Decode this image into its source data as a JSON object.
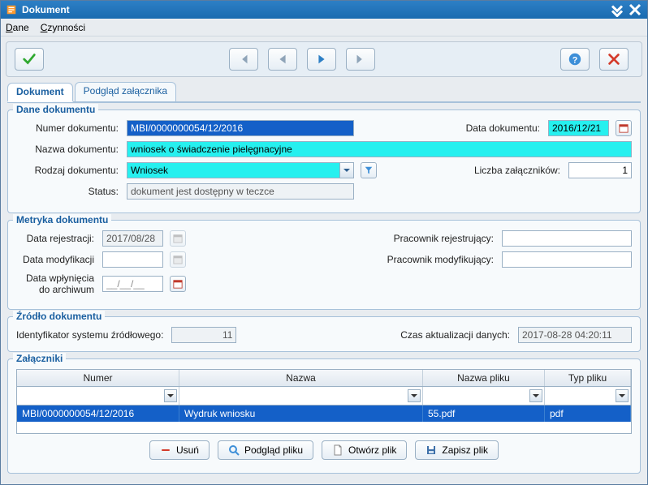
{
  "window": {
    "title": "Dokument"
  },
  "menubar": {
    "dane": "Dane",
    "czynnosci": "Czynności"
  },
  "tabs": {
    "dokument": "Dokument",
    "podglad": "Podgląd załącznika"
  },
  "dane_dokumentu": {
    "legend": "Dane dokumentu",
    "numer_label": "Numer dokumentu:",
    "numer_value": "MBI/0000000054/12/2016",
    "data_label": "Data dokumentu:",
    "data_value": "2016/12/21",
    "nazwa_label": "Nazwa dokumentu:",
    "nazwa_value": "wniosek o świadczenie pielęgnacyjne",
    "rodzaj_label": "Rodzaj dokumentu:",
    "rodzaj_value": "Wniosek",
    "liczba_label": "Liczba załączników:",
    "liczba_value": "1",
    "status_label": "Status:",
    "status_value": "dokument jest dostępny w teczce"
  },
  "metryka": {
    "legend": "Metryka dokumentu",
    "data_rej_label": "Data rejestracji:",
    "data_rej_value": "2017/08/28",
    "prac_rej_label": "Pracownik rejestrujący:",
    "prac_rej_value": "",
    "data_mod_label": "Data modyfikacji",
    "data_mod_value": "",
    "prac_mod_label": "Pracownik modyfikujący:",
    "prac_mod_value": "",
    "data_arch_label": "Data wpłynięcia do archiwum",
    "data_arch_value": "__/__/__"
  },
  "zrodlo": {
    "legend": "Źródło dokumentu",
    "id_label": "Identyfikator systemu źródłowego:",
    "id_value": "11",
    "czas_label": "Czas aktualizacji danych:",
    "czas_value": "2017-08-28 04:20:11"
  },
  "zalaczniki": {
    "legend": "Załączniki",
    "columns": {
      "numer": "Numer",
      "nazwa": "Nazwa",
      "nazwa_pliku": "Nazwa pliku",
      "typ_pliku": "Typ pliku"
    },
    "row": {
      "numer": "MBI/0000000054/12/2016",
      "nazwa": "Wydruk wniosku",
      "nazwa_pliku": "55.pdf",
      "typ_pliku": "pdf"
    }
  },
  "buttons": {
    "usun": "Usuń",
    "podglad": "Podgląd pliku",
    "otworz": "Otwórz plik",
    "zapisz": "Zapisz plik"
  }
}
